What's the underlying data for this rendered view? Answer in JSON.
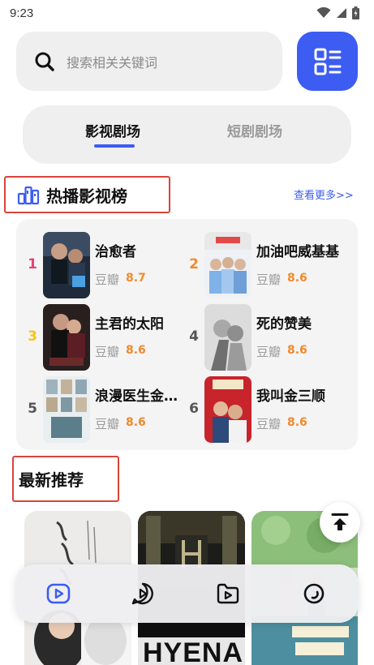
{
  "status_bar": {
    "time": "9:23"
  },
  "search": {
    "placeholder": "搜索相关关键词"
  },
  "tabs": [
    {
      "label": "影视剧场",
      "active": true
    },
    {
      "label": "短剧剧场",
      "active": false
    }
  ],
  "hot": {
    "title": "热播影视榜",
    "more_label": "查看更多>>",
    "items": [
      {
        "rank": "1",
        "title": "治愈者",
        "source": "豆瓣",
        "score": "8.7",
        "rank_color": "#e0457a"
      },
      {
        "rank": "2",
        "title": "加油吧威基基",
        "source": "豆瓣",
        "score": "8.6",
        "rank_color": "#f08a2c"
      },
      {
        "rank": "3",
        "title": "主君的太阳",
        "source": "豆瓣",
        "score": "8.6",
        "rank_color": "#f5c518"
      },
      {
        "rank": "4",
        "title": "死的赞美",
        "source": "豆瓣",
        "score": "8.6",
        "rank_color": "#555555"
      },
      {
        "rank": "5",
        "title": "浪漫医生金师傅",
        "source": "豆瓣",
        "score": "8.6",
        "rank_color": "#555555"
      },
      {
        "rank": "6",
        "title": "我叫金三顺",
        "source": "豆瓣",
        "score": "8.6",
        "rank_color": "#555555"
      }
    ]
  },
  "latest": {
    "title": "最新推荐",
    "cards": [
      {
        "poster_text": "HYENA"
      }
    ]
  },
  "colors": {
    "accent": "#3c5cf2",
    "highlight_box": "#d9443a",
    "score": "#f08a2c"
  },
  "bottom_nav": [
    {
      "icon": "video-icon",
      "active": true
    },
    {
      "icon": "play-bubble-icon",
      "active": false
    },
    {
      "icon": "folder-play-icon",
      "active": false
    },
    {
      "icon": "circle-icon",
      "active": false
    }
  ]
}
